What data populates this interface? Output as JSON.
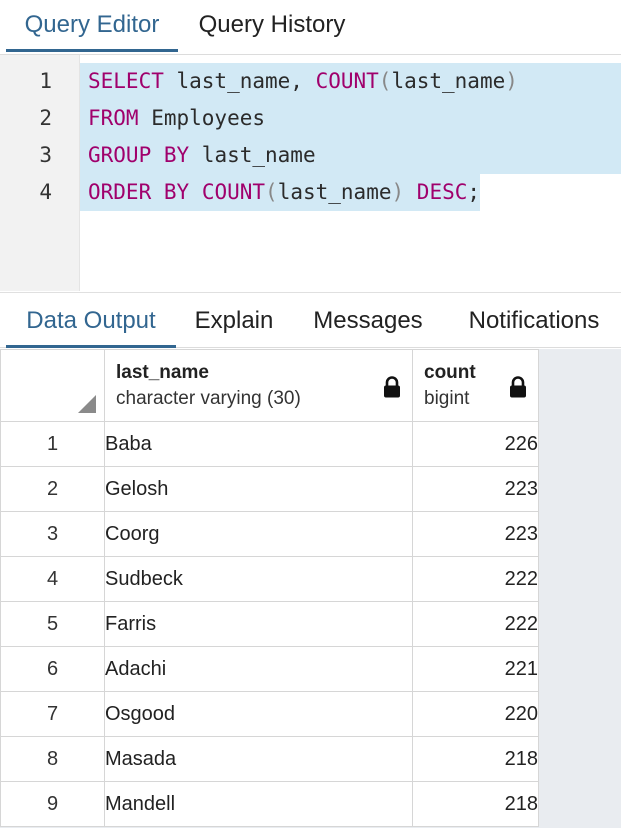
{
  "top_tabs": [
    {
      "label": "Query Editor",
      "active": true
    },
    {
      "label": "Query History",
      "active": false
    }
  ],
  "editor": {
    "line_numbers": [
      "1",
      "2",
      "3",
      "4"
    ],
    "lines": [
      [
        {
          "t": "kw",
          "v": "SELECT"
        },
        {
          "t": "tx",
          "v": " last_name, "
        },
        {
          "t": "kw",
          "v": "COUNT"
        },
        {
          "t": "pn",
          "v": "("
        },
        {
          "t": "tx",
          "v": "last_name"
        },
        {
          "t": "pn",
          "v": ")"
        }
      ],
      [
        {
          "t": "kw",
          "v": "FROM"
        },
        {
          "t": "tx",
          "v": " Employees"
        }
      ],
      [
        {
          "t": "kw",
          "v": "GROUP BY"
        },
        {
          "t": "tx",
          "v": " last_name"
        }
      ],
      [
        {
          "t": "kw",
          "v": "ORDER BY"
        },
        {
          "t": "tx",
          "v": " "
        },
        {
          "t": "kw",
          "v": "COUNT"
        },
        {
          "t": "pn",
          "v": "("
        },
        {
          "t": "tx",
          "v": "last_name"
        },
        {
          "t": "pn",
          "v": ")"
        },
        {
          "t": "tx",
          "v": " "
        },
        {
          "t": "kw",
          "v": "DESC"
        },
        {
          "t": "tx",
          "v": ";"
        }
      ]
    ]
  },
  "output_tabs": [
    {
      "label": "Data Output",
      "active": true
    },
    {
      "label": "Explain",
      "active": false
    },
    {
      "label": "Messages",
      "active": false
    },
    {
      "label": "Notifications",
      "active": false
    }
  ],
  "grid": {
    "columns": [
      {
        "name": "last_name",
        "type": "character varying (30)"
      },
      {
        "name": "count",
        "type": "bigint"
      }
    ],
    "rows": [
      {
        "num": "1",
        "last_name": "Baba",
        "count": "226"
      },
      {
        "num": "2",
        "last_name": "Gelosh",
        "count": "223"
      },
      {
        "num": "3",
        "last_name": "Coorg",
        "count": "223"
      },
      {
        "num": "4",
        "last_name": "Sudbeck",
        "count": "222"
      },
      {
        "num": "5",
        "last_name": "Farris",
        "count": "222"
      },
      {
        "num": "6",
        "last_name": "Adachi",
        "count": "221"
      },
      {
        "num": "7",
        "last_name": "Osgood",
        "count": "220"
      },
      {
        "num": "8",
        "last_name": "Masada",
        "count": "218"
      },
      {
        "num": "9",
        "last_name": "Mandell",
        "count": "218"
      }
    ]
  },
  "colors": {
    "accent": "#326690",
    "keyword": "#a0006c",
    "selection": "#d2e9f5",
    "gutter": "#f2f2f2"
  }
}
